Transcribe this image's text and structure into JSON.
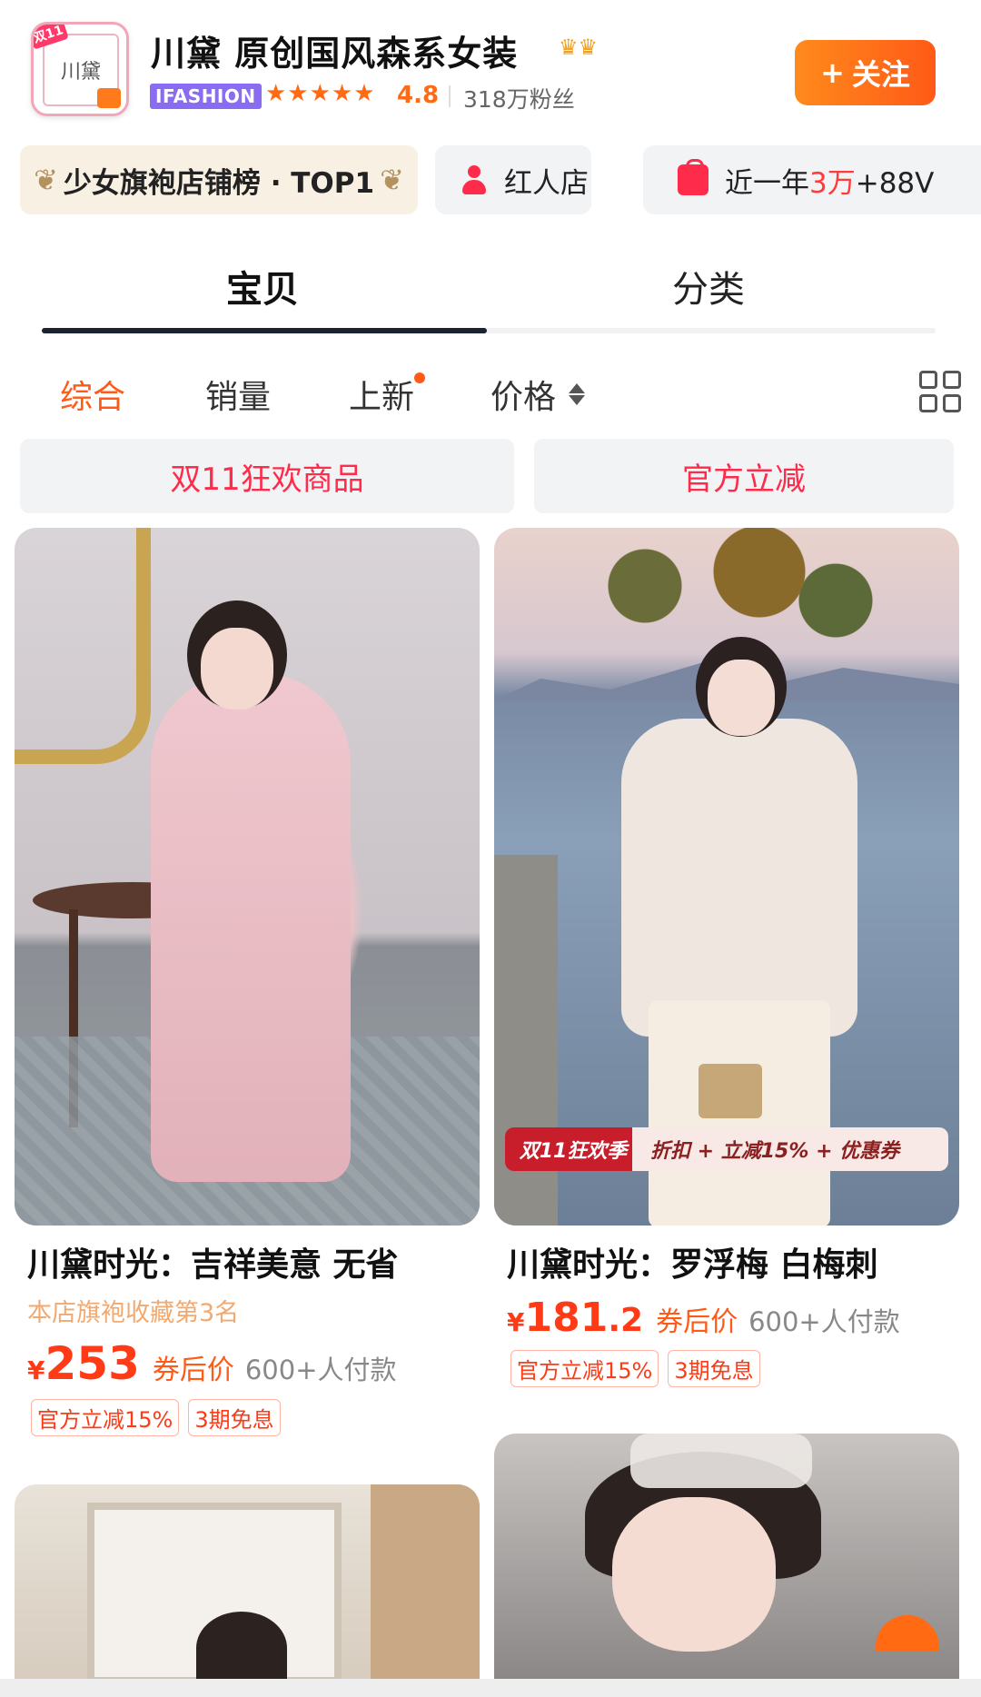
{
  "shop": {
    "name": "川黛 原创国风森系女装",
    "logo_text": "川黛",
    "logo_tag": "双11",
    "crowns": "♛♛",
    "badge": "IFASHION",
    "stars": "★★★★★",
    "rating": "4.8",
    "fans": "318万粉丝",
    "follow_label": "关注",
    "follow_icon": "+"
  },
  "chips": {
    "top_rank": "少女旗袍店铺榜 · TOP1",
    "influencer": "红人店",
    "year_prefix": "近一年",
    "year_highlight": "3万",
    "year_suffix": "+88V"
  },
  "tabs": {
    "items": [
      "宝贝",
      "分类"
    ],
    "active": "宝贝"
  },
  "sort": {
    "items": [
      "综合",
      "销量",
      "上新",
      "价格"
    ],
    "active": "综合"
  },
  "promo": {
    "double11": "双11狂欢商品",
    "official": "官方立减"
  },
  "products": [
    {
      "title": "川黛时光：吉祥美意 无省",
      "subtitle": "本店旗袍收藏第3名",
      "currency": "¥",
      "price_int": "253",
      "price_dec": "",
      "price_label": "券后价",
      "buyers": "600+人付款",
      "tags": [
        "官方立减15%",
        "3期免息"
      ]
    },
    {
      "title": "川黛时光：罗浮梅 白梅刺",
      "subtitle": "",
      "currency": "¥",
      "price_int": "181",
      "price_dec": ".2",
      "price_label": "券后价",
      "buyers": "600+人付款",
      "tags": [
        "官方立减15%",
        "3期免息"
      ],
      "banner_left": "双11狂欢季",
      "banner_right": "折扣 + 立减15% + 优惠券"
    }
  ],
  "colors": {
    "accent_orange": "#ff5a17",
    "price_red": "#ff3b17",
    "promo_red": "#ff2b4b",
    "tab_indicator": "#1b2333"
  }
}
